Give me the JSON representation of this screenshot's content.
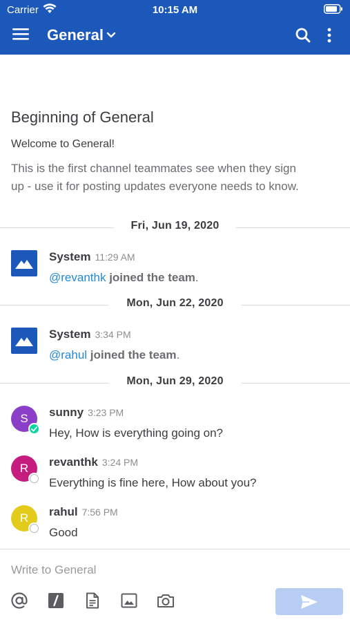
{
  "status_bar": {
    "carrier": "Carrier",
    "time": "10:15 AM"
  },
  "header": {
    "channel_name": "General"
  },
  "intro": {
    "title": "Beginning of General",
    "welcome": "Welcome to General!",
    "description_line1": "This is the first channel teammates see when they sign",
    "description_line2": "up - use it for posting updates everyone needs to know."
  },
  "dates": [
    "Fri, Jun 19, 2020",
    "Mon, Jun 22, 2020",
    "Mon, Jun 29, 2020"
  ],
  "posts": [
    {
      "author": "System",
      "time": "11:29 AM",
      "mention": "@revanthk",
      "text": "joined the team",
      "end": "."
    },
    {
      "author": "System",
      "time": "3:34 PM",
      "mention": "@rahul",
      "text": "joined the team",
      "end": "."
    },
    {
      "author": "sunny",
      "time": "3:23 PM",
      "initial": "S",
      "text": "Hey, How is everything going on?"
    },
    {
      "author": "revanthk",
      "time": "3:24 PM",
      "initial": "R",
      "text": "Everything is fine here, How about you?"
    },
    {
      "author": "rahul",
      "time": "7:56 PM",
      "initial": "R",
      "text": "Good"
    }
  ],
  "composer": {
    "placeholder": "Write to General"
  },
  "colors": {
    "header": "#1c58b9",
    "avatar_sunny": "#8b3fc9",
    "avatar_revanthk": "#c61c7d",
    "avatar_rahul": "#e2cb1b",
    "online": "#06d6a0",
    "send_disabled": "#b7cdf1"
  }
}
